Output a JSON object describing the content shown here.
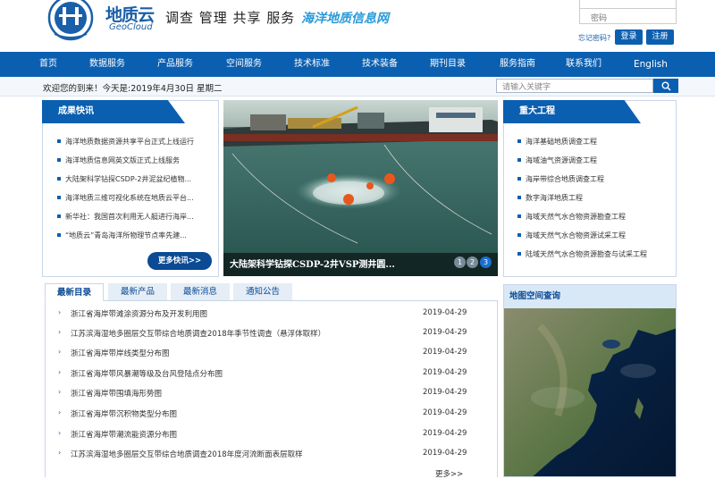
{
  "header": {
    "logo_cn": "地质云",
    "logo_en": "GeoCloud",
    "slogan": "调查 管理 共享 服务",
    "subsite": "海洋地质信息网",
    "password_placeholder": "密码",
    "forgot": "忘记密码?",
    "login": "登录",
    "register": "注册"
  },
  "nav": [
    "首页",
    "数据服务",
    "产品服务",
    "空间服务",
    "技术标准",
    "技术装备",
    "期刊目录",
    "服务指南",
    "联系我们",
    "English"
  ],
  "welcome": "欢迎您的到来！今天是:2019年4月30日 星期二",
  "search": {
    "placeholder": "请输入关键字"
  },
  "achievements": {
    "title": "成果快讯",
    "items": [
      "海洋地质数据资源共享平台正式上线运行",
      "海洋地质信息网英文版正式上线服务",
      "大陆架科学钻探CSDP-2井泥盆纪植物...",
      "海洋地质三维可视化系统在地质云平台...",
      "新华社：我国首次利用无人艇进行海岸...",
      "“地质云”青岛海洋所物理节点率先建..."
    ],
    "more": "更多快讯>>"
  },
  "slide": {
    "caption": "大陆架科学钻探CSDP-2井VSP测井圆...",
    "dots": [
      "1",
      "2",
      "3"
    ]
  },
  "projects": {
    "title": "重大工程",
    "items": [
      "海洋基础地质调查工程",
      "海域油气资源调查工程",
      "海岸带综合地质调查工程",
      "数字海洋地质工程",
      "海域天然气水合物资源勘查工程",
      "海域天然气水合物资源试采工程",
      "陆域天然气水合物资源勘查与试采工程"
    ]
  },
  "tabs": [
    "最新目录",
    "最新产品",
    "最新消息",
    "通知公告"
  ],
  "catalog": [
    {
      "title": "浙江省海岸带滩涂资源分布及开发利用图",
      "date": "2019-04-29"
    },
    {
      "title": "江苏滨海湿地多圈层交互带综合地质调查2018年季节性调查（悬浮体取样）",
      "date": "2019-04-29"
    },
    {
      "title": "浙江省海岸带岸线类型分布图",
      "date": "2019-04-29"
    },
    {
      "title": "浙江省海岸带风暴潮等级及台风登陆点分布图",
      "date": "2019-04-29"
    },
    {
      "title": "浙江省海岸带围填海形势图",
      "date": "2019-04-29"
    },
    {
      "title": "浙江省海岸带沉积物类型分布图",
      "date": "2019-04-29"
    },
    {
      "title": "浙江省海岸带潮流能资源分布图",
      "date": "2019-04-29"
    },
    {
      "title": "江苏滨海湿地多圈层交互带综合地质调查2018年度河流断面表层取样",
      "date": "2019-04-29"
    }
  ],
  "catalog_more": "更多>>",
  "map": {
    "title": "地图空间查询"
  },
  "colors": {
    "primary": "#0b5fb0",
    "accent": "#2a9ad8"
  }
}
